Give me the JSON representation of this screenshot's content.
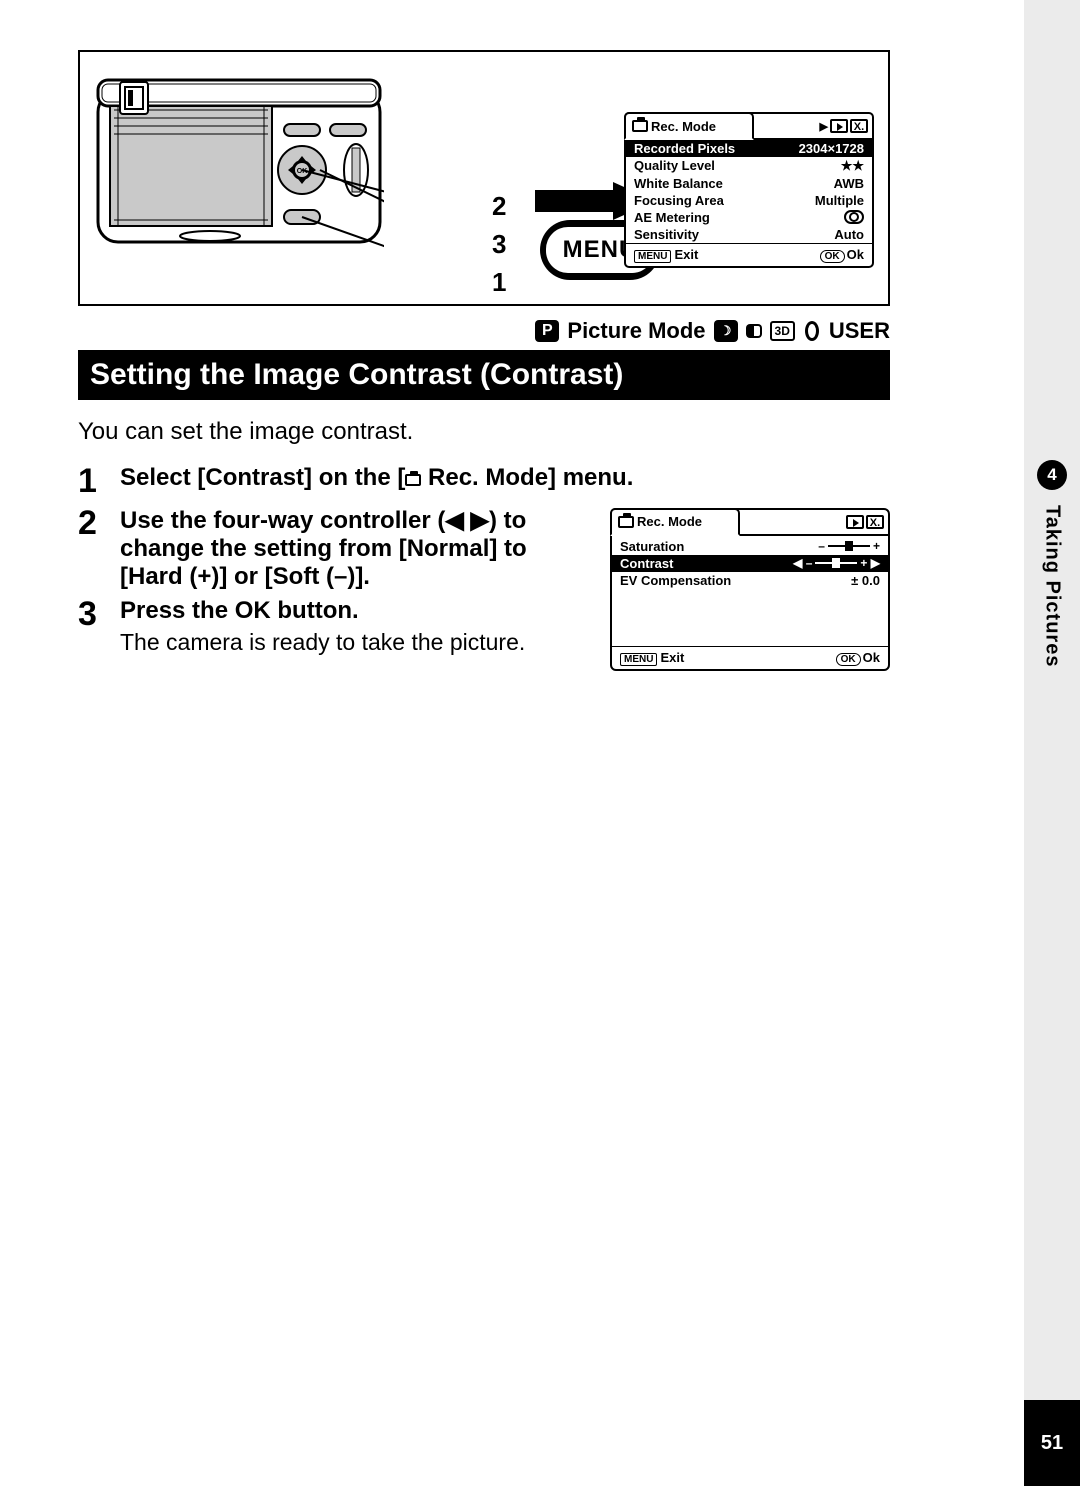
{
  "sideTab": {
    "chapterNum": "4",
    "chapterTitle": "Taking Pictures"
  },
  "pageNumber": "51",
  "callouts": {
    "a": "2",
    "b": "3",
    "c": "1"
  },
  "menuButton": "MENU",
  "lcd1": {
    "tabLabel": "Rec. Mode",
    "rows": [
      {
        "label": "Recorded Pixels",
        "value": "2304×1728"
      },
      {
        "label": "Quality Level",
        "value": "★★"
      },
      {
        "label": "White Balance",
        "value": "AWB"
      },
      {
        "label": "Focusing Area",
        "value": "Multiple"
      },
      {
        "label": "AE Metering",
        "value": "⦿"
      },
      {
        "label": "Sensitivity",
        "value": "Auto"
      }
    ],
    "footerLeftBadge": "MENU",
    "footerLeft": "Exit",
    "footerRightBadge": "OK",
    "footerRight": "Ok"
  },
  "modeBar": {
    "p": "P",
    "label": "Picture Mode",
    "threeD": "3D",
    "user": "USER"
  },
  "heading": "Setting the Image Contrast (Contrast)",
  "intro": "You can set the image contrast.",
  "steps": [
    {
      "num": "1",
      "title_pre": "Select [Contrast] on the [",
      "title_post": " Rec. Mode] menu."
    },
    {
      "num": "2",
      "title": "Use the four-way controller (◀ ▶) to change the setting from [Normal] to [Hard (+)] or [Soft (–)]."
    },
    {
      "num": "3",
      "title": "Press the OK button.",
      "note": "The camera is ready to take the picture."
    }
  ],
  "lcd2": {
    "tabLabel": "Rec. Mode",
    "rows": [
      {
        "label": "Saturation",
        "left": "–",
        "right": "+"
      },
      {
        "label": "Contrast",
        "left": "◀ –",
        "right": "+ ▶",
        "selected": true
      },
      {
        "label": "EV Compensation",
        "value": "±  0.0"
      }
    ],
    "footerLeftBadge": "MENU",
    "footerLeft": "Exit",
    "footerRightBadge": "OK",
    "footerRight": "Ok"
  }
}
